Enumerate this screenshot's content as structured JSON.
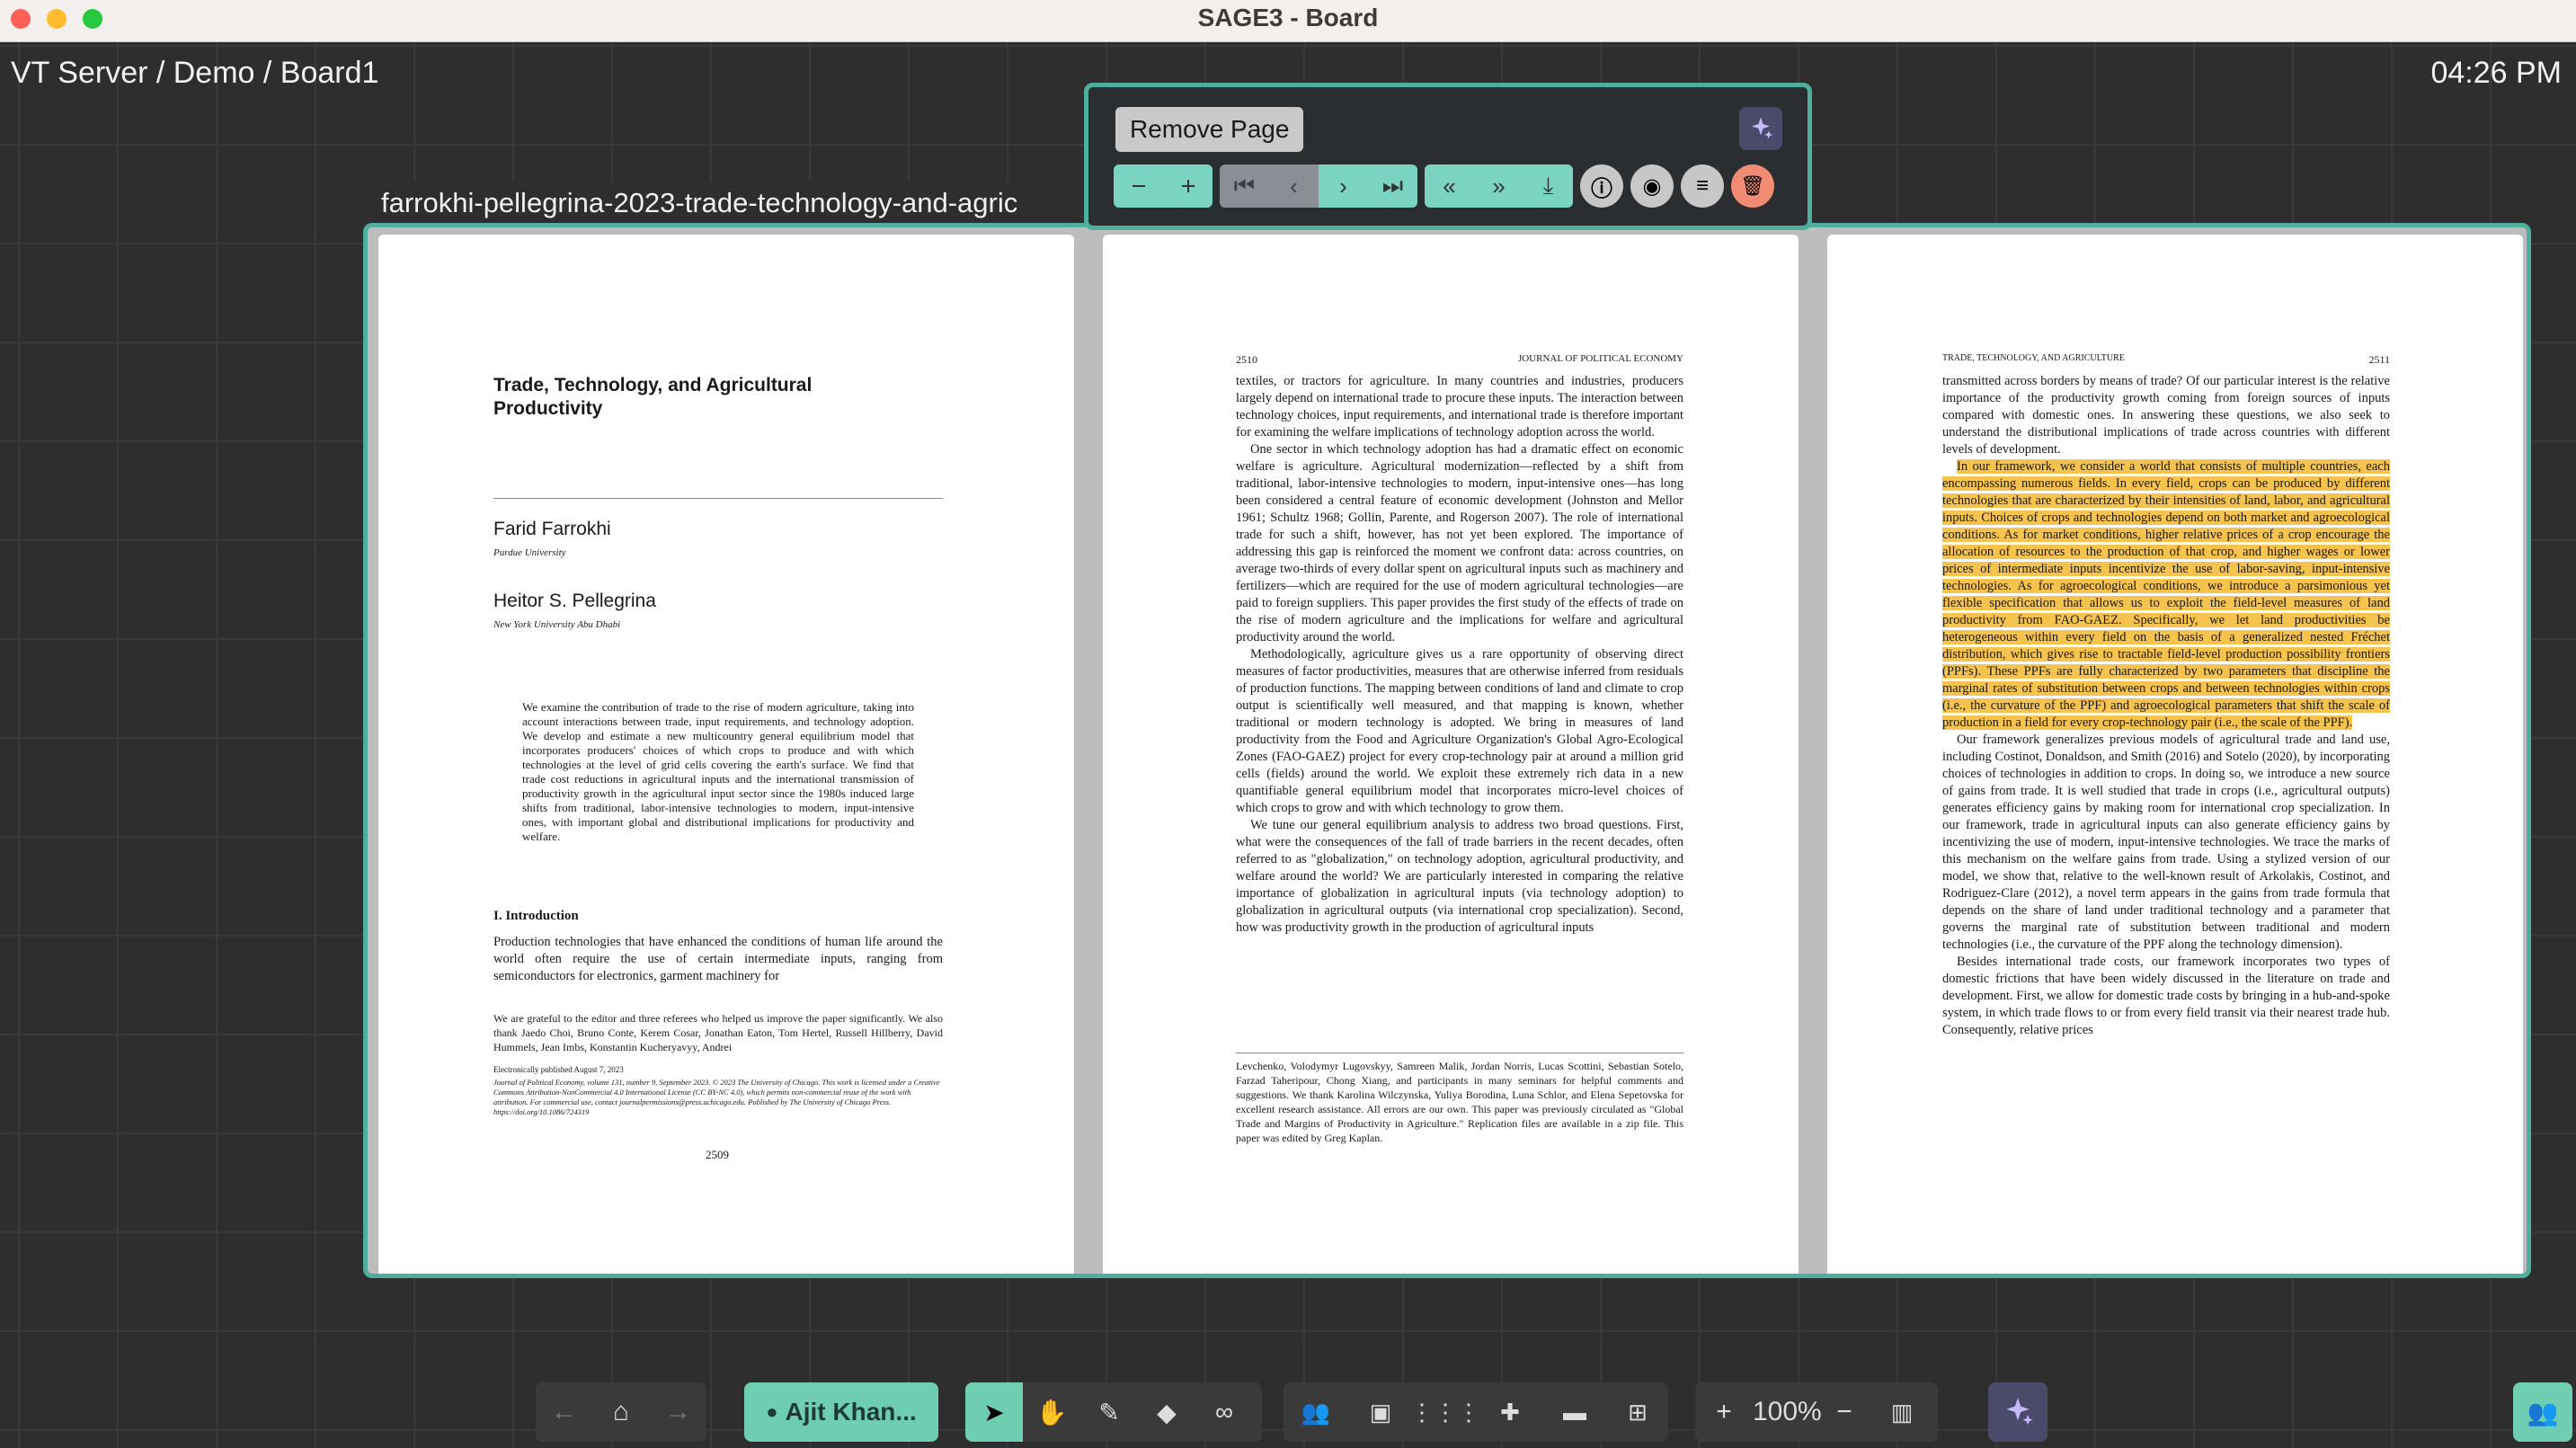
{
  "window": {
    "title": "SAGE3 - Board"
  },
  "board": {
    "breadcrumb": "VT Server / Demo / Board1",
    "time": "04:26 PM"
  },
  "pdf": {
    "title": "farrokhi-pellegrina-2023-trade-technology-and-agric",
    "tooltip": "Remove Page",
    "page1": {
      "title": "Trade, Technology, and Agricultural Productivity",
      "author1": "Farid Farrokhi",
      "affil1": "Purdue University",
      "author2": "Heitor S. Pellegrina",
      "affil2": "New York University Abu Dhabi",
      "abstract": "We examine the contribution of trade to the rise of modern agriculture, taking into account interactions between trade, input requirements, and technology adoption. We develop and estimate a new multicountry general equilibrium model that incorporates producers' choices of which crops to produce and with which technologies at the level of grid cells covering the earth's surface. We find that trade cost reductions in agricultural inputs and the international transmission of productivity growth in the agricultural input sector since the 1980s induced large shifts from traditional, labor-intensive technologies to modern, input-intensive ones, with important global and distributional implications for productivity and welfare.",
      "section": "I.   Introduction",
      "intro": "Production technologies that have enhanced the conditions of human life around the world often require the use of certain intermediate inputs, ranging from semiconductors for electronics, garment machinery for",
      "footnote": "We are grateful to the editor and three referees who helped us improve the paper significantly. We also thank Jaedo Choi, Bruno Conte, Kerem Cosar, Jonathan Eaton, Tom Hertel, Russell Hillberry, David Hummels, Jean Imbs, Konstantin Kucheryavyy, Andrei",
      "pub": "Electronically published August 7, 2023",
      "journal": "Journal of Political Economy, volume 131, number 9, September 2023. © 2023 The University of Chicago. This work is licensed under a Creative Commons Attribution-NonCommercial 4.0 International License (CC BY-NC 4.0), which permits non-commercial reuse of the work with attribution. For commercial use, contact journalpermissions@press.uchicago.edu. Published by The University of Chicago Press. https://doi.org/10.1086/724319",
      "pagenum": "2509"
    },
    "page2": {
      "pagenum": "2510",
      "header": "JOURNAL OF POLITICAL ECONOMY",
      "para1": "textiles, or tractors for agriculture. In many countries and industries, producers largely depend on international trade to procure these inputs. The interaction between technology choices, input requirements, and international trade is therefore important for examining the welfare implications of technology adoption across the world.",
      "para2": "One sector in which technology adoption has had a dramatic effect on economic welfare is agriculture. Agricultural modernization—reflected by a shift from traditional, labor-intensive technologies to modern, input-intensive ones—has long been considered a central feature of economic development (Johnston and Mellor 1961; Schultz 1968; Gollin, Parente, and Rogerson 2007). The role of international trade for such a shift, however, has not yet been explored. The importance of addressing this gap is reinforced the moment we confront data: across countries, on average two-thirds of every dollar spent on agricultural inputs such as machinery and fertilizers—which are required for the use of modern agricultural technologies—are paid to foreign suppliers. This paper provides the first study of the effects of trade on the rise of modern agriculture and the implications for welfare and agricultural productivity around the world.",
      "para3": "Methodologically, agriculture gives us a rare opportunity of observing direct measures of factor productivities, measures that are otherwise inferred from residuals of production functions. The mapping between conditions of land and climate to crop output is scientifically well measured, and that mapping is known, whether traditional or modern technology is adopted. We bring in measures of land productivity from the Food and Agriculture Organization's Global Agro-Ecological Zones (FAO-GAEZ) project for every crop-technology pair at around a million grid cells (fields) around the world. We exploit these extremely rich data in a new quantifiable general equilibrium model that incorporates micro-level choices of which crops to grow and with which technology to grow them.",
      "para4": "We tune our general equilibrium analysis to address two broad questions. First, what were the consequences of the fall of trade barriers in the recent decades, often referred to as \"globalization,\" on technology adoption, agricultural productivity, and welfare around the world? We are particularly interested in comparing the relative importance of globalization in agricultural inputs (via technology adoption) to globalization in agricultural outputs (via international crop specialization). Second, how was productivity growth in the production of agricultural inputs",
      "footnote": "Levchenko, Volodymyr Lugovskyy, Samreen Malik, Jordan Norris, Lucas Scottini, Sebastian Sotelo, Farzad Taheripour, Chong Xiang, and participants in many seminars for helpful comments and suggestions. We thank Karolina Wilczynska, Yuliya Borodina, Luna Schlor, and Elena Sepetovska for excellent research assistance. All errors are our own. This paper was previously circulated as \"Global Trade and Margins of Productivity in Agriculture.\" Replication files are available in a zip file. This paper was edited by Greg Kaplan."
    },
    "page3": {
      "header": "TRADE, TECHNOLOGY, AND AGRICULTURE",
      "pagenum": "2511",
      "para1": "transmitted across borders by means of trade? Of our particular interest is the relative importance of the productivity growth coming from foreign sources of inputs compared with domestic ones. In answering these questions, we also seek to understand the distributional implications of trade across countries with different levels of development.",
      "highlight": "In our framework, we consider a world that consists of multiple countries, each encompassing numerous fields. In every field, crops can be produced by different technologies that are characterized by their intensities of land, labor, and agricultural inputs. Choices of crops and technologies depend on both market and agroecological conditions. As for market conditions, higher relative prices of a crop encourage the allocation of resources to the production of that crop, and higher wages or lower prices of intermediate inputs incentivize the use of labor-saving, input-intensive technologies. As for agroecological conditions, we introduce a parsimonious yet flexible specification that allows us to exploit the field-level measures of land productivity from FAO-GAEZ. Specifically, we let land productivities be heterogeneous within every field on the basis of a generalized nested Fréchet distribution, which gives rise to tractable field-level production possibility frontiers (PPFs). These PPFs are fully characterized by two parameters that discipline the marginal rates of substitution between crops and between technologies within crops (i.e., the curvature of the PPF) and agroecological parameters that shift the scale of production in a field for every crop-technology pair (i.e., the scale of the PPF).",
      "para2": "Our framework generalizes previous models of agricultural trade and land use, including Costinot, Donaldson, and Smith (2016) and Sotelo (2020), by incorporating choices of technologies in addition to crops. In doing so, we introduce a new source of gains from trade. It is well studied that trade in crops (i.e., agricultural outputs) generates efficiency gains by making room for international crop specialization. In our framework, trade in agricultural inputs can also generate efficiency gains by incentivizing the use of modern, input-intensive technologies. We trace the marks of this mechanism on the welfare gains from trade. Using a stylized version of our model, we show that, relative to the well-known result of Arkolakis, Costinot, and Rodriguez-Clare (2012), a novel term appears in the gains from trade formula that depends on the share of land under traditional technology and a parameter that governs the marginal rate of substitution between traditional and modern technologies (i.e., the curvature of the PPF along the technology dimension).",
      "para3": "Besides international trade costs, our framework incorporates two types of domestic frictions that have been widely discussed in the literature on trade and development. First, we allow for domestic trade costs by bringing in a hub-and-spoke system, in which trade flows to or from every field transit via their nearest trade hub. Consequently, relative prices"
    }
  },
  "dock": {
    "user": "Ajit Khan...",
    "zoom": "100%"
  }
}
